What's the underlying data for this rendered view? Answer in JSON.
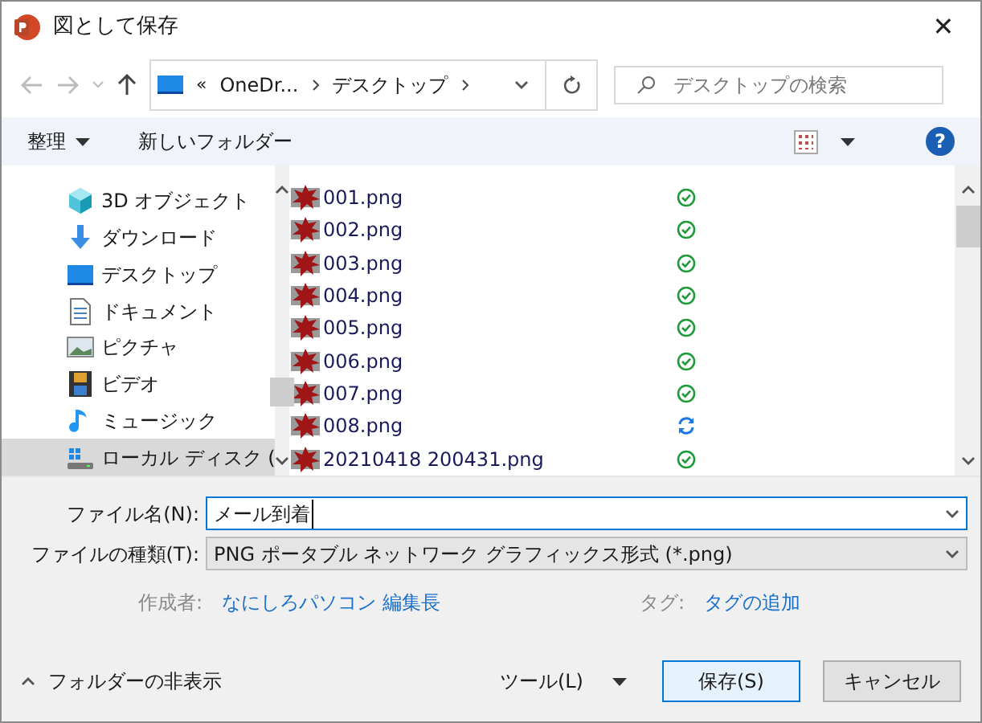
{
  "window": {
    "title": "図として保存",
    "close": "✕"
  },
  "address": {
    "overflow": "«",
    "segments": [
      "OneDr...",
      "デスクトップ"
    ]
  },
  "search": {
    "placeholder": "デスクトップの検索"
  },
  "toolbar": {
    "organize": "整理",
    "new_folder": "新しいフォルダー",
    "help": "?"
  },
  "sidebar": {
    "items": [
      {
        "kind": "cube",
        "label": "3D オブジェクト",
        "selected": false
      },
      {
        "kind": "download",
        "label": "ダウンロード",
        "selected": false
      },
      {
        "kind": "desktop",
        "label": "デスクトップ",
        "selected": false
      },
      {
        "kind": "document",
        "label": "ドキュメント",
        "selected": false
      },
      {
        "kind": "picture",
        "label": "ピクチャ",
        "selected": false
      },
      {
        "kind": "video",
        "label": "ビデオ",
        "selected": false
      },
      {
        "kind": "music",
        "label": "ミュージック",
        "selected": false
      },
      {
        "kind": "disk",
        "label": "ローカル ディスク (",
        "selected": true
      }
    ]
  },
  "files": [
    {
      "name": "001.png",
      "kind": "synced"
    },
    {
      "name": "002.png",
      "kind": "synced"
    },
    {
      "name": "003.png",
      "kind": "synced"
    },
    {
      "name": "004.png",
      "kind": "synced"
    },
    {
      "name": "005.png",
      "kind": "synced"
    },
    {
      "name": "006.png",
      "kind": "synced"
    },
    {
      "name": "007.png",
      "kind": "synced"
    },
    {
      "name": "008.png",
      "kind": "syncing"
    },
    {
      "name": "20210418 200431.png",
      "kind": "synced"
    }
  ],
  "form": {
    "filename_label": "ファイル名(N):",
    "filename": "メール到着",
    "type_label": "ファイルの種類(T):",
    "type": "PNG ポータブル ネットワーク グラフィックス形式 (*.png)",
    "author_label": "作成者:",
    "author": "なにしろパソコン 編集長",
    "tags_label": "タグ:",
    "tags": "タグの追加"
  },
  "footer": {
    "hide_folders": "フォルダーの非表示",
    "tools": "ツール(L)",
    "save": "保存(S)",
    "cancel": "キャンセル"
  }
}
